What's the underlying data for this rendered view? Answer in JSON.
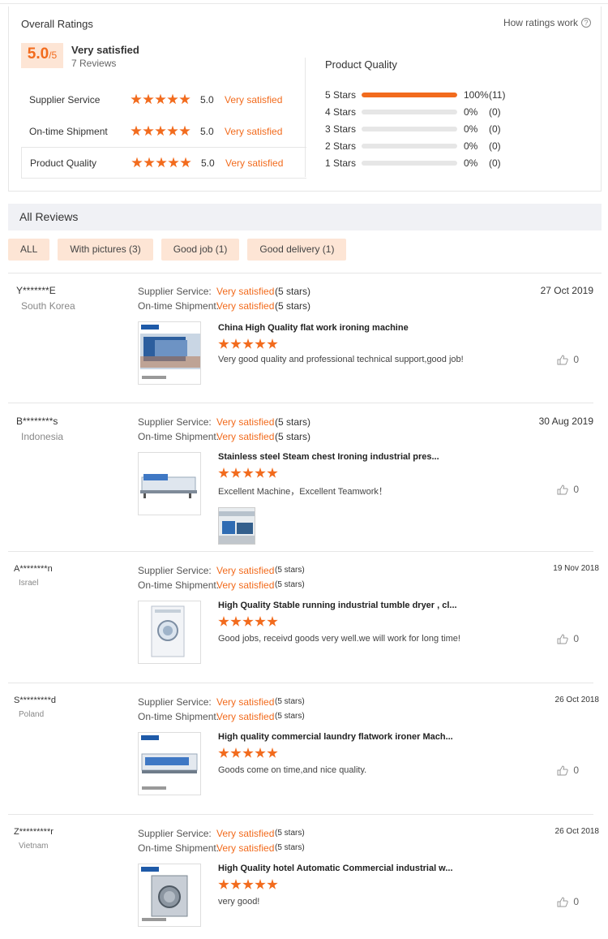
{
  "overall": {
    "title": "Overall Ratings",
    "how_link": "How ratings work",
    "help_glyph": "?",
    "score": "5.0",
    "score_den": "/5",
    "satisfaction": "Very satisfied",
    "reviews_count": "7 Reviews",
    "sub_ratings": [
      {
        "label": "Supplier Service",
        "score": "5.0",
        "sat": "Very satisfied"
      },
      {
        "label": "On-time Shipment",
        "score": "5.0",
        "sat": "Very satisfied"
      },
      {
        "label": "Product Quality",
        "score": "5.0",
        "sat": "Very satisfied"
      }
    ],
    "product_quality": {
      "title": "Product Quality",
      "rows": [
        {
          "label": "5 Stars",
          "pct": "100%",
          "count": "(11)",
          "fraction": 1.0
        },
        {
          "label": "4 Stars",
          "pct": "0%",
          "count": "(0)",
          "fraction": 0
        },
        {
          "label": "3 Stars",
          "pct": "0%",
          "count": "(0)",
          "fraction": 0
        },
        {
          "label": "2 Stars",
          "pct": "0%",
          "count": "(0)",
          "fraction": 0
        },
        {
          "label": "1 Stars",
          "pct": "0%",
          "count": "(0)",
          "fraction": 0
        }
      ]
    }
  },
  "all_reviews": {
    "title": "All Reviews",
    "filters": [
      "ALL",
      "With pictures (3)",
      "Good job (1)",
      "Good delivery (1)"
    ]
  },
  "labels": {
    "supplier_service": "Supplier Service:",
    "ontime_shipment": "On-time Shipment:",
    "very_satisfied": "Very satisfied",
    "five_stars": "(5 stars)"
  },
  "reviews": [
    {
      "user": "Y*******E",
      "country": "South Korea",
      "date": "27 Oct 2019",
      "product": "China High Quality flat work ironing machine",
      "text": "Very good quality and professional technical support,good job!",
      "likes": "0"
    },
    {
      "user": "B********s",
      "country": "Indonesia",
      "date": "30 Aug 2019",
      "product": "Stainless steel Steam chest Ironing industrial pres...",
      "text": "Excellent Machine，Excellent Teamwork！",
      "likes": "0"
    },
    {
      "user": "A********n",
      "country": "Israel",
      "date": "19 Nov 2018",
      "product": "High Quality Stable running industrial tumble dryer , cl...",
      "text": "Good jobs, receivd goods very well.we will work for long time!",
      "likes": "0"
    },
    {
      "user": "S*********d",
      "country": "Poland",
      "date": "26 Oct 2018",
      "product": "High quality commercial laundry flatwork ironer Mach...",
      "text": "Goods come on time,and nice quality.",
      "likes": "0"
    },
    {
      "user": "Z*********r",
      "country": "Vietnam",
      "date": "26 Oct 2018",
      "product": "High Quality hotel Automatic Commercial industrial w...",
      "text": "very good!",
      "likes": "0"
    }
  ],
  "colors": {
    "accent": "#f26b1d",
    "accent_bg": "#fde5d5"
  }
}
